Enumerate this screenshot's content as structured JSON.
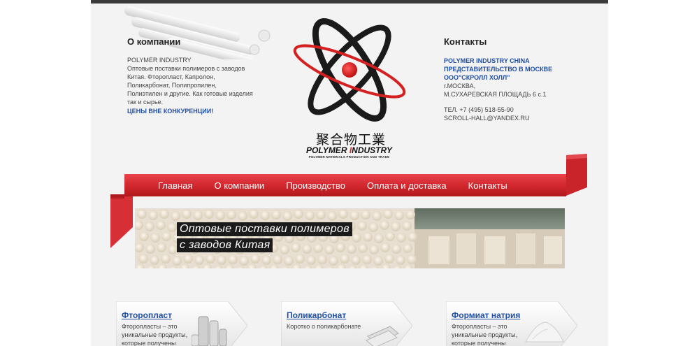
{
  "about": {
    "heading": "О компании",
    "brand": "POLYMER INDUSTRY",
    "desc_lines": [
      "Оптовые поставки полимеров с заводов",
      "Китая. Фторопласт, Капролон,",
      "Поликарбонат, Полипропилен,",
      "Полиэтилен и другие. Как готовые изделия",
      "так и сырье."
    ],
    "promo": "ЦЕНЫ ВНЕ КОНКУРЕНЦИИ!"
  },
  "logo": {
    "chinese": "聚合物工業",
    "en_left": "POLYMER ",
    "en_red": "I",
    "en_right": "NDUSTRY",
    "subtitle": "POLYMER MATERIALS PRODUCTION AND TRADE"
  },
  "contacts": {
    "heading": "Контакты",
    "blue_lines": [
      "POLYMER INDUSTRY CHINA",
      "ПРЕДСТАВИТЕЛЬСТВО В МОСКВЕ",
      "ООО\"СКРОЛЛ ХОЛЛ\""
    ],
    "address_lines": [
      "г.МОСКВА,",
      "М.СУХАРЕВСКАЯ ПЛОЩАДЬ 6 с.1"
    ],
    "phone": "ТЕЛ. +7 (495) 518-55-90",
    "email": "SCROLL-HALL@YANDEX.RU"
  },
  "nav": {
    "items": [
      "Главная",
      "О компании",
      "Производство",
      "Оплата и доставка",
      "Контакты"
    ]
  },
  "banner": {
    "line1": "Оптовые поставки полимеров",
    "line2": "с заводов Китая"
  },
  "cards": [
    {
      "title": "Фторопласт",
      "text": "Фторопласты – это уникальные продукты, которые получены",
      "image": "ptfe-rods-image"
    },
    {
      "title": "Поликарбонат",
      "text": "Коротко о поликарбонате",
      "image": "polycarbonate-sheets-image"
    },
    {
      "title": "Формиат натрия",
      "text": "Фторопласты – это уникальные продукты, которые получены",
      "image": "powder-pile-image"
    }
  ],
  "colors": {
    "accent_red": "#d0262c",
    "link_blue": "#1f4fa8",
    "page_bg": "#f3f3f3"
  }
}
